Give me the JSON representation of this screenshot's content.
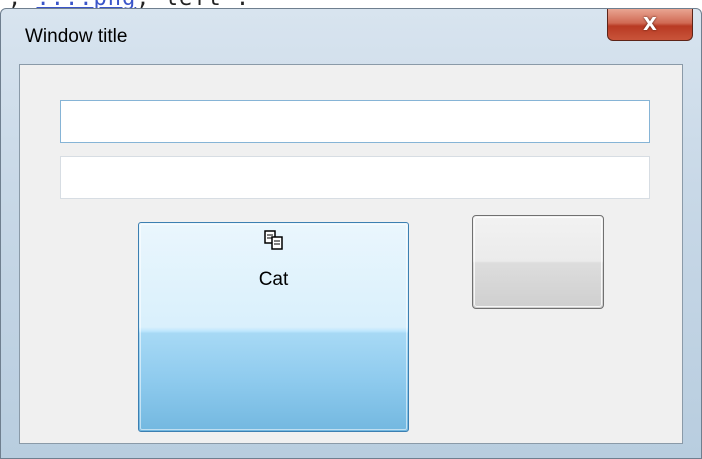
{
  "background": {
    "partial_text_prefix": ", ",
    "partial_text_link": "....png",
    "partial_text_suffix": ", left :"
  },
  "window": {
    "title": "Window title",
    "close_glyph": "X"
  },
  "main": {
    "textbox1_value": "",
    "textbox2_value": "",
    "cat_button": {
      "label": "Cat",
      "icon": "copy-icon",
      "icon_glyph": "⧉"
    },
    "plain_button_label": ""
  },
  "colors": {
    "close_button": "#c9543a",
    "cat_button_top": "#eaf6fd",
    "cat_button_bottom": "#73b8e0",
    "client_background": "#f0f0f0"
  }
}
